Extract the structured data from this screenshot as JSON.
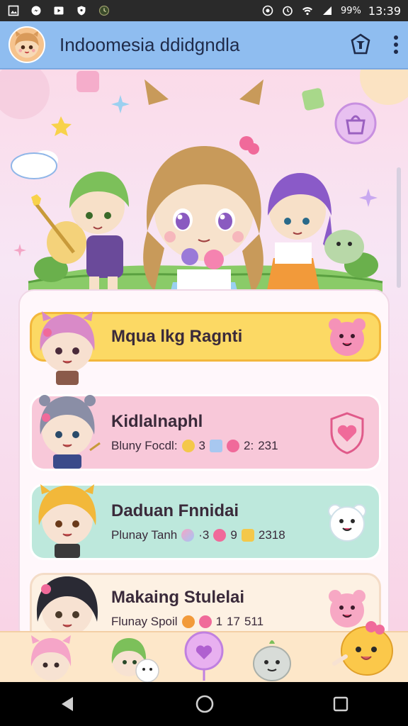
{
  "status_bar": {
    "battery": "99%",
    "time": "13:39",
    "icons": [
      "photo-icon",
      "messenger-icon",
      "play-icon",
      "shield-icon",
      "clock-icon",
      "hotspot-icon",
      "alarm-icon",
      "wifi-icon",
      "signal-icon",
      "battery-icon"
    ]
  },
  "app_bar": {
    "title": "Indoomesia ddidgndla",
    "actions": [
      "logo-badge-icon",
      "more-vert-icon"
    ]
  },
  "list": {
    "cards": [
      {
        "title": "Mqua lkg Ragnti",
        "subtitle": "",
        "badge": "pink-bear-face-icon",
        "color": "#fcd964"
      },
      {
        "title": "Kidlalnaphl",
        "subtitle_label": "Bluny Focdl:",
        "subtitle_stats": [
          "3",
          "2:",
          "231"
        ],
        "badge": "heart-shield-icon",
        "color": "#f8c8d9"
      },
      {
        "title": "Daduan Fnnidai",
        "subtitle_label": "Plunay Tanh",
        "subtitle_stats": [
          "·3",
          "9",
          "2318"
        ],
        "badge": "white-bear-face-icon",
        "color": "#bde8dc"
      },
      {
        "title": "Makaing Stulelai",
        "subtitle_label": "Flunay Spoil",
        "subtitle_stats": [
          "1",
          "17",
          "511"
        ],
        "badge": "pink-bear-face-icon",
        "color": "#fdf1e3"
      }
    ]
  },
  "nav_bar": {
    "buttons": [
      "back-icon",
      "home-icon",
      "recents-icon"
    ]
  }
}
